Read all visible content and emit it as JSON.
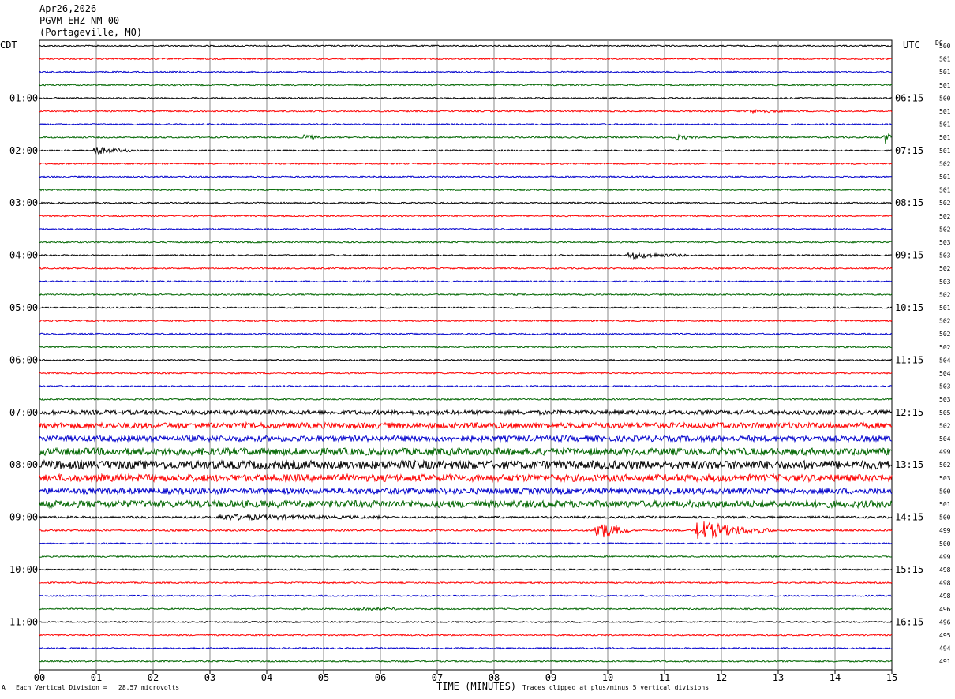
{
  "header": {
    "date": "Apr26,2026",
    "station": "PGVM EHZ NM 00",
    "location": "(Portageville, MO)"
  },
  "left_tz": "CDT",
  "right_tz": "UTC",
  "dc_label": "DC",
  "x_axis_title": "TIME (MINUTES)",
  "footer": {
    "mark": "A",
    "scale_note": "Each Vertical Division =   28.57 microvolts",
    "clip_note": "Traces clipped at plus/minus 5 vertical divisions"
  },
  "colors": {
    "cycle": [
      "#000000",
      "#ff0000",
      "#0000cc",
      "#006600"
    ],
    "grid": "#888888"
  },
  "chart_data": {
    "type": "line",
    "title": "PGVM EHZ NM 00",
    "xlabel": "TIME (MINUTES)",
    "xlim": [
      0,
      15
    ],
    "x_ticks": [
      "00",
      "01",
      "02",
      "03",
      "04",
      "05",
      "06",
      "07",
      "08",
      "09",
      "10",
      "11",
      "12",
      "13",
      "14",
      "15"
    ],
    "left_hour_labels": [
      "01:00",
      "02:00",
      "03:00",
      "04:00",
      "05:00",
      "06:00",
      "07:00",
      "08:00",
      "09:00",
      "10:00",
      "11:00"
    ],
    "right_hour_labels": [
      "06:15",
      "07:15",
      "08:15",
      "09:15",
      "10:15",
      "11:15",
      "12:15",
      "13:15",
      "14:15",
      "15:15",
      "16:15"
    ],
    "trace_count": 48,
    "dc_offsets": [
      500,
      501,
      501,
      501,
      500,
      501,
      501,
      501,
      501,
      502,
      501,
      501,
      502,
      502,
      502,
      503,
      503,
      502,
      503,
      502,
      501,
      502,
      502,
      502,
      504,
      504,
      503,
      503,
      505,
      502,
      504,
      499,
      502,
      503,
      500,
      501,
      500,
      499,
      500,
      499,
      498,
      498,
      498,
      496,
      496,
      495,
      494,
      491
    ],
    "noise_levels": [
      1,
      1,
      1,
      1,
      1,
      1,
      1,
      1,
      1,
      1,
      1,
      1,
      1,
      1,
      1,
      1,
      1,
      1,
      1,
      1,
      1,
      1,
      1,
      1,
      1,
      1,
      1,
      1,
      3,
      4,
      4,
      5,
      6,
      5,
      4,
      5,
      1.5,
      1.2,
      1,
      1,
      1,
      1,
      1,
      1,
      1,
      1,
      1,
      1
    ],
    "events": [
      {
        "trace": 5,
        "minute": 12.5,
        "duration": 0.6,
        "amplitude": 2
      },
      {
        "trace": 7,
        "minute": 4.7,
        "duration": 0.3,
        "amplitude": 3
      },
      {
        "trace": 7,
        "minute": 11.2,
        "duration": 0.4,
        "amplitude": 3
      },
      {
        "trace": 7,
        "minute": 14.9,
        "duration": 0.15,
        "amplitude": 8
      },
      {
        "trace": 8,
        "minute": 1.0,
        "duration": 0.6,
        "amplitude": 5
      },
      {
        "trace": 16,
        "minute": 10.4,
        "duration": 1.0,
        "amplitude": 4
      },
      {
        "trace": 36,
        "minute": 3.2,
        "duration": 3.0,
        "amplitude": 3
      },
      {
        "trace": 37,
        "minute": 9.8,
        "duration": 0.6,
        "amplitude": 14
      },
      {
        "trace": 37,
        "minute": 11.6,
        "duration": 1.3,
        "amplitude": 12
      },
      {
        "trace": 43,
        "minute": 5.6,
        "duration": 0.8,
        "amplitude": 2
      }
    ]
  }
}
